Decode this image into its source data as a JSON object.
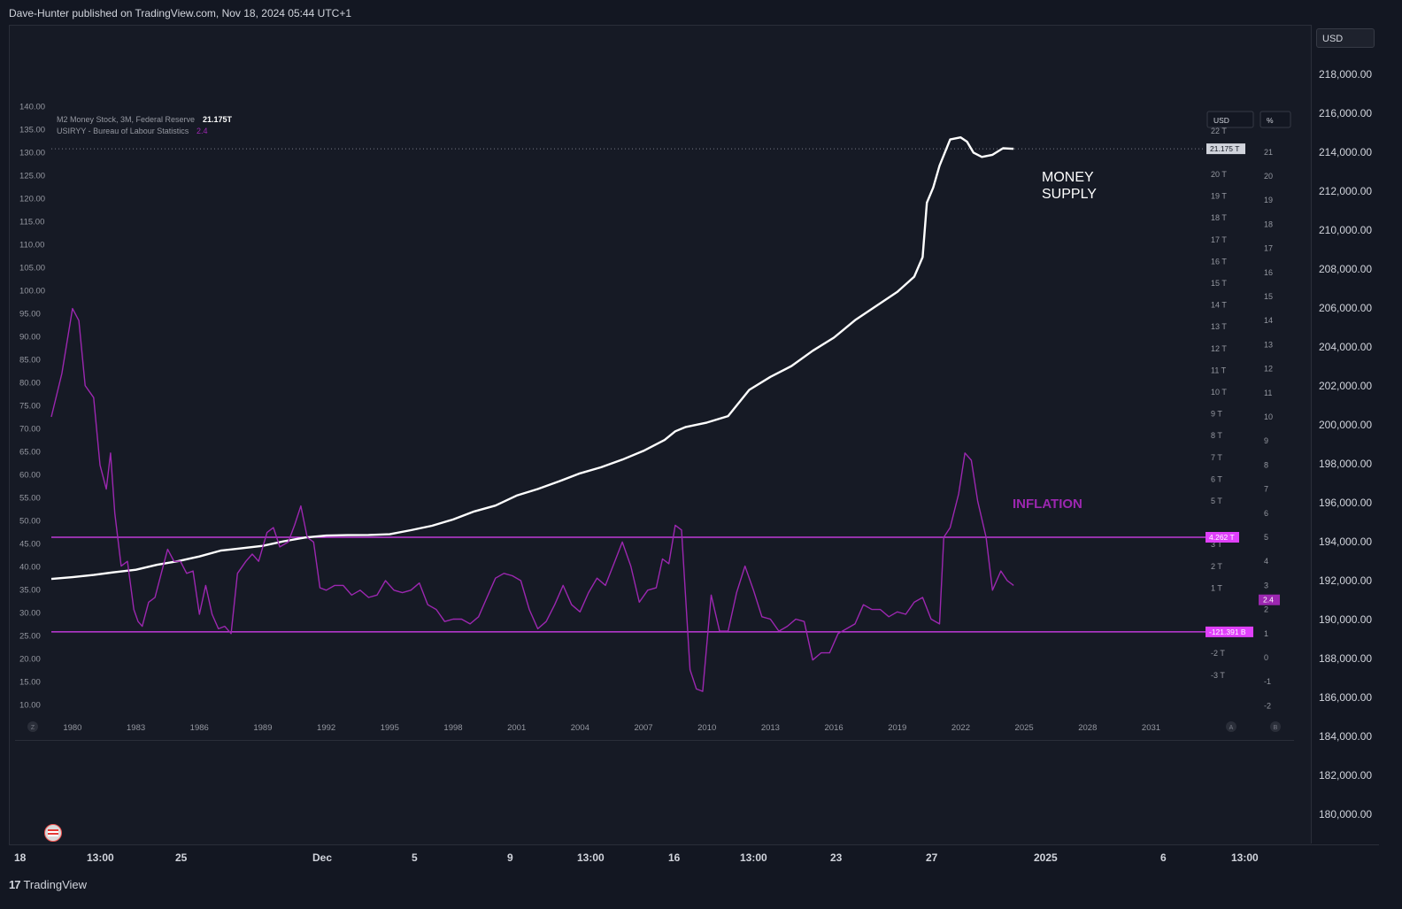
{
  "header": {
    "publisher_line": "Dave-Hunter published on TradingView.com, Nov 18, 2024 05:44 UTC+1"
  },
  "footer": {
    "brand": "TradingView",
    "brand_logo": "17"
  },
  "outer_scale": {
    "currency_button": "USD",
    "labels": [
      "218,000.00",
      "216,000.00",
      "214,000.00",
      "212,000.00",
      "210,000.00",
      "208,000.00",
      "206,000.00",
      "204,000.00",
      "202,000.00",
      "200,000.00",
      "198,000.00",
      "196,000.00",
      "194,000.00",
      "192,000.00",
      "190,000.00",
      "188,000.00",
      "186,000.00",
      "184,000.00",
      "182,000.00",
      "180,000.00"
    ]
  },
  "outer_time_axis": [
    "18",
    "13:00",
    "25",
    "Dec",
    "5",
    "9",
    "13:00",
    "16",
    "13:00",
    "23",
    "27",
    "2025",
    "6",
    "13:00"
  ],
  "chart_data": {
    "type": "line",
    "legend": [
      {
        "name": "M2 Money Stock, 3M, Federal Reserve",
        "value": "21.175T",
        "color": "#ffffff"
      },
      {
        "name": "USIRYY - Bureau of Labour Statistics",
        "value": "2.4",
        "color": "#9c27b0"
      }
    ],
    "left_axis_ticks": [
      "140.00",
      "135.00",
      "130.00",
      "125.00",
      "120.00",
      "115.00",
      "110.00",
      "105.00",
      "100.00",
      "95.00",
      "90.00",
      "85.00",
      "80.00",
      "75.00",
      "70.00",
      "65.00",
      "60.00",
      "55.00",
      "50.00",
      "45.00",
      "40.00",
      "35.00",
      "30.00",
      "25.00",
      "20.00",
      "15.00",
      "10.00"
    ],
    "x_ticks": [
      "1980",
      "1983",
      "1986",
      "1989",
      "1992",
      "1995",
      "1998",
      "2001",
      "2004",
      "2007",
      "2010",
      "2013",
      "2016",
      "2019",
      "2022",
      "2025",
      "2028",
      "2031"
    ],
    "x_range": [
      1979.0,
      2033.7
    ],
    "money_axis": {
      "button": "USD",
      "ticks": [
        {
          "v": 22,
          "label": "22 T"
        },
        {
          "v": 20,
          "label": "20 T"
        },
        {
          "v": 19,
          "label": "19 T"
        },
        {
          "v": 18,
          "label": "18 T"
        },
        {
          "v": 17,
          "label": "17 T"
        },
        {
          "v": 16,
          "label": "16 T"
        },
        {
          "v": 15,
          "label": "15 T"
        },
        {
          "v": 14,
          "label": "14 T"
        },
        {
          "v": 13,
          "label": "13 T"
        },
        {
          "v": 12,
          "label": "12 T"
        },
        {
          "v": 11,
          "label": "11 T"
        },
        {
          "v": 10,
          "label": "10 T"
        },
        {
          "v": 9,
          "label": "9 T"
        },
        {
          "v": 8,
          "label": "8 T"
        },
        {
          "v": 7,
          "label": "7 T"
        },
        {
          "v": 6,
          "label": "6 T"
        },
        {
          "v": 5,
          "label": "5 T"
        },
        {
          "v": 3,
          "label": "3 T"
        },
        {
          "v": 2,
          "label": "2 T"
        },
        {
          "v": 1,
          "label": "1 T"
        },
        {
          "v": -1,
          "label": "-1 T"
        },
        {
          "v": -2,
          "label": "-2 T"
        },
        {
          "v": -3,
          "label": "-3 T"
        }
      ],
      "current_label": "21.175 T",
      "current_value": 21.175
    },
    "pct_axis": {
      "button": "%",
      "ticks": [
        21,
        20,
        19,
        18,
        17,
        16,
        15,
        14,
        13,
        12,
        11,
        10,
        9,
        8,
        7,
        6,
        5,
        4,
        3,
        2,
        1,
        0,
        -1,
        -2
      ],
      "current_label": "2.4",
      "current_value": 2.4
    },
    "horizontal_lines": [
      {
        "value_pct": 5.0,
        "label": "4.262 T",
        "color": "#e040fb"
      },
      {
        "value_pct": 1.07,
        "label": "-121.391 B",
        "color": "#e040fb"
      }
    ],
    "annotations": [
      {
        "text_lines": [
          "MONEY",
          "SUPPLY"
        ],
        "color": "#ffffff"
      },
      {
        "text": "INFLATION",
        "color": "#9c27b0"
      }
    ],
    "scale_buttons": {
      "log": "Z",
      "auto": "A",
      "b": "B"
    },
    "series": [
      {
        "name": "M2 Money Stock",
        "unit": "T",
        "color": "#ffffff",
        "x": [
          1979.0,
          1980,
          1981,
          1982,
          1983,
          1984,
          1985,
          1986,
          1987,
          1988,
          1989,
          1990,
          1991,
          1992,
          1993,
          1994,
          1995,
          1996,
          1997,
          1998,
          1999,
          2000,
          2001,
          2002,
          2003,
          2004,
          2005,
          2006,
          2007,
          2008,
          2008.5,
          2009,
          2010,
          2011,
          2011.5,
          2012,
          2013,
          2014,
          2015,
          2016,
          2017,
          2018,
          2019,
          2019.8,
          2020.2,
          2020.4,
          2020.7,
          2021,
          2021.5,
          2022,
          2022.3,
          2022.6,
          2023,
          2023.5,
          2024,
          2024.5
        ],
        "y": [
          1.42,
          1.5,
          1.6,
          1.73,
          1.84,
          2.07,
          2.24,
          2.45,
          2.72,
          2.83,
          2.94,
          3.15,
          3.32,
          3.41,
          3.43,
          3.44,
          3.47,
          3.66,
          3.86,
          4.15,
          4.52,
          4.79,
          5.25,
          5.55,
          5.9,
          6.27,
          6.55,
          6.9,
          7.3,
          7.8,
          8.2,
          8.4,
          8.6,
          8.9,
          9.5,
          10.1,
          10.7,
          11.2,
          11.9,
          12.5,
          13.3,
          13.95,
          14.6,
          15.3,
          16.2,
          18.7,
          19.4,
          20.4,
          21.6,
          21.7,
          21.5,
          21.0,
          20.8,
          20.9,
          21.2,
          21.175
        ]
      },
      {
        "name": "USIRYY",
        "unit": "%",
        "color": "#9c27b0",
        "x": [
          1979.0,
          1979.5,
          1980.0,
          1980.3,
          1980.6,
          1981.0,
          1981.3,
          1981.6,
          1981.8,
          1982.0,
          1982.3,
          1982.6,
          1982.9,
          1983.1,
          1983.3,
          1983.6,
          1983.9,
          1984.2,
          1984.5,
          1984.8,
          1985.1,
          1985.4,
          1985.7,
          1986.0,
          1986.3,
          1986.6,
          1986.9,
          1987.2,
          1987.5,
          1987.8,
          1988.2,
          1988.5,
          1988.8,
          1989.2,
          1989.5,
          1989.8,
          1990.2,
          1990.5,
          1990.8,
          1991.1,
          1991.4,
          1991.7,
          1992.0,
          1992.4,
          1992.8,
          1993.2,
          1993.6,
          1994.0,
          1994.4,
          1994.8,
          1995.2,
          1995.6,
          1996.0,
          1996.4,
          1996.8,
          1997.2,
          1997.6,
          1998.0,
          1998.4,
          1998.8,
          1999.2,
          1999.6,
          2000.0,
          2000.4,
          2000.8,
          2001.2,
          2001.6,
          2002.0,
          2002.4,
          2002.8,
          2003.2,
          2003.6,
          2004.0,
          2004.4,
          2004.8,
          2005.2,
          2005.6,
          2006.0,
          2006.4,
          2006.8,
          2007.2,
          2007.6,
          2007.9,
          2008.2,
          2008.5,
          2008.8,
          2009.2,
          2009.5,
          2009.8,
          2010.2,
          2010.6,
          2011.0,
          2011.4,
          2011.8,
          2012.2,
          2012.6,
          2013.0,
          2013.4,
          2013.8,
          2014.2,
          2014.6,
          2015.0,
          2015.4,
          2015.8,
          2016.2,
          2016.6,
          2017.0,
          2017.4,
          2017.8,
          2018.2,
          2018.6,
          2019.0,
          2019.4,
          2019.8,
          2020.2,
          2020.6,
          2021.0,
          2021.2,
          2021.5,
          2021.9,
          2022.2,
          2022.5,
          2022.8,
          2023.2,
          2023.5,
          2023.9,
          2024.2,
          2024.5
        ],
        "y": [
          10.0,
          11.8,
          14.5,
          14.0,
          11.3,
          10.8,
          8.0,
          7.0,
          8.5,
          6.0,
          3.8,
          4.0,
          2.0,
          1.5,
          1.3,
          2.3,
          2.5,
          3.5,
          4.5,
          4.0,
          4.0,
          3.5,
          3.6,
          1.8,
          3.0,
          1.8,
          1.2,
          1.3,
          1.0,
          3.5,
          4.0,
          4.3,
          4.0,
          5.2,
          5.4,
          4.6,
          4.8,
          5.5,
          6.3,
          5.0,
          4.8,
          2.9,
          2.8,
          3.0,
          3.0,
          2.6,
          2.8,
          2.5,
          2.6,
          3.2,
          2.8,
          2.7,
          2.8,
          3.1,
          2.2,
          2.0,
          1.5,
          1.6,
          1.6,
          1.4,
          1.7,
          2.5,
          3.3,
          3.5,
          3.4,
          3.2,
          2.0,
          1.2,
          1.5,
          2.2,
          3.0,
          2.2,
          1.9,
          2.7,
          3.3,
          3.0,
          3.9,
          4.8,
          3.8,
          2.3,
          2.8,
          2.9,
          4.1,
          3.9,
          5.5,
          5.3,
          -0.5,
          -1.3,
          -1.4,
          2.6,
          1.1,
          1.1,
          2.7,
          3.8,
          2.8,
          1.7,
          1.6,
          1.1,
          1.3,
          1.6,
          1.5,
          -0.1,
          0.2,
          0.2,
          1.0,
          1.2,
          1.4,
          2.2,
          2.0,
          2.0,
          1.7,
          1.9,
          1.8,
          2.3,
          2.5,
          1.6,
          1.4,
          5.0,
          5.4,
          6.8,
          8.5,
          8.2,
          6.5,
          5.0,
          2.8,
          3.6,
          3.2,
          3.0
        ]
      }
    ]
  }
}
